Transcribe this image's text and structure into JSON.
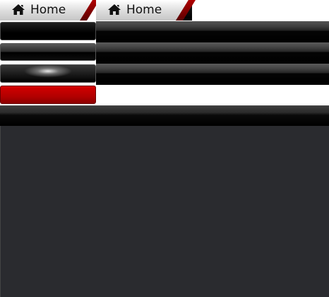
{
  "tabs": [
    {
      "label": "Home",
      "icon": "home-icon"
    },
    {
      "label": "Home",
      "icon": "home-icon"
    }
  ],
  "colors": {
    "accent_red": "#c00000",
    "panel": "#2a2b2f",
    "tab_light": "#e6e6e6"
  }
}
